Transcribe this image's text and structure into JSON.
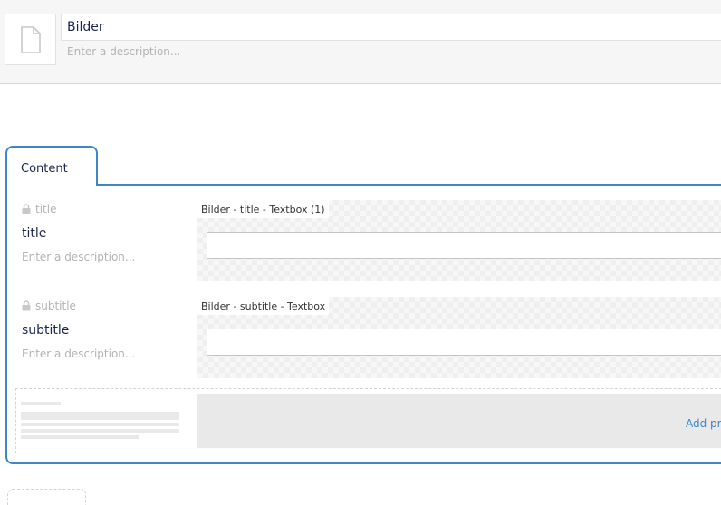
{
  "header": {
    "name_value": "Bilder",
    "description_placeholder": "Enter a description...",
    "icon": "document-icon"
  },
  "group": {
    "tab_label": "Content"
  },
  "properties": [
    {
      "alias": "title",
      "label": "title",
      "description_placeholder": "Enter a description...",
      "editor_label": "Bilder - title - Textbox (1)",
      "value": ""
    },
    {
      "alias": "subtitle",
      "label": "subtitle",
      "description_placeholder": "Enter a description...",
      "editor_label": "Bilder - subtitle - Textbox",
      "value": ""
    }
  ],
  "add_property": {
    "label": "Add pr"
  },
  "colors": {
    "accent": "#3f86c9",
    "text": "#1b264f",
    "muted": "#b3b3b3"
  }
}
